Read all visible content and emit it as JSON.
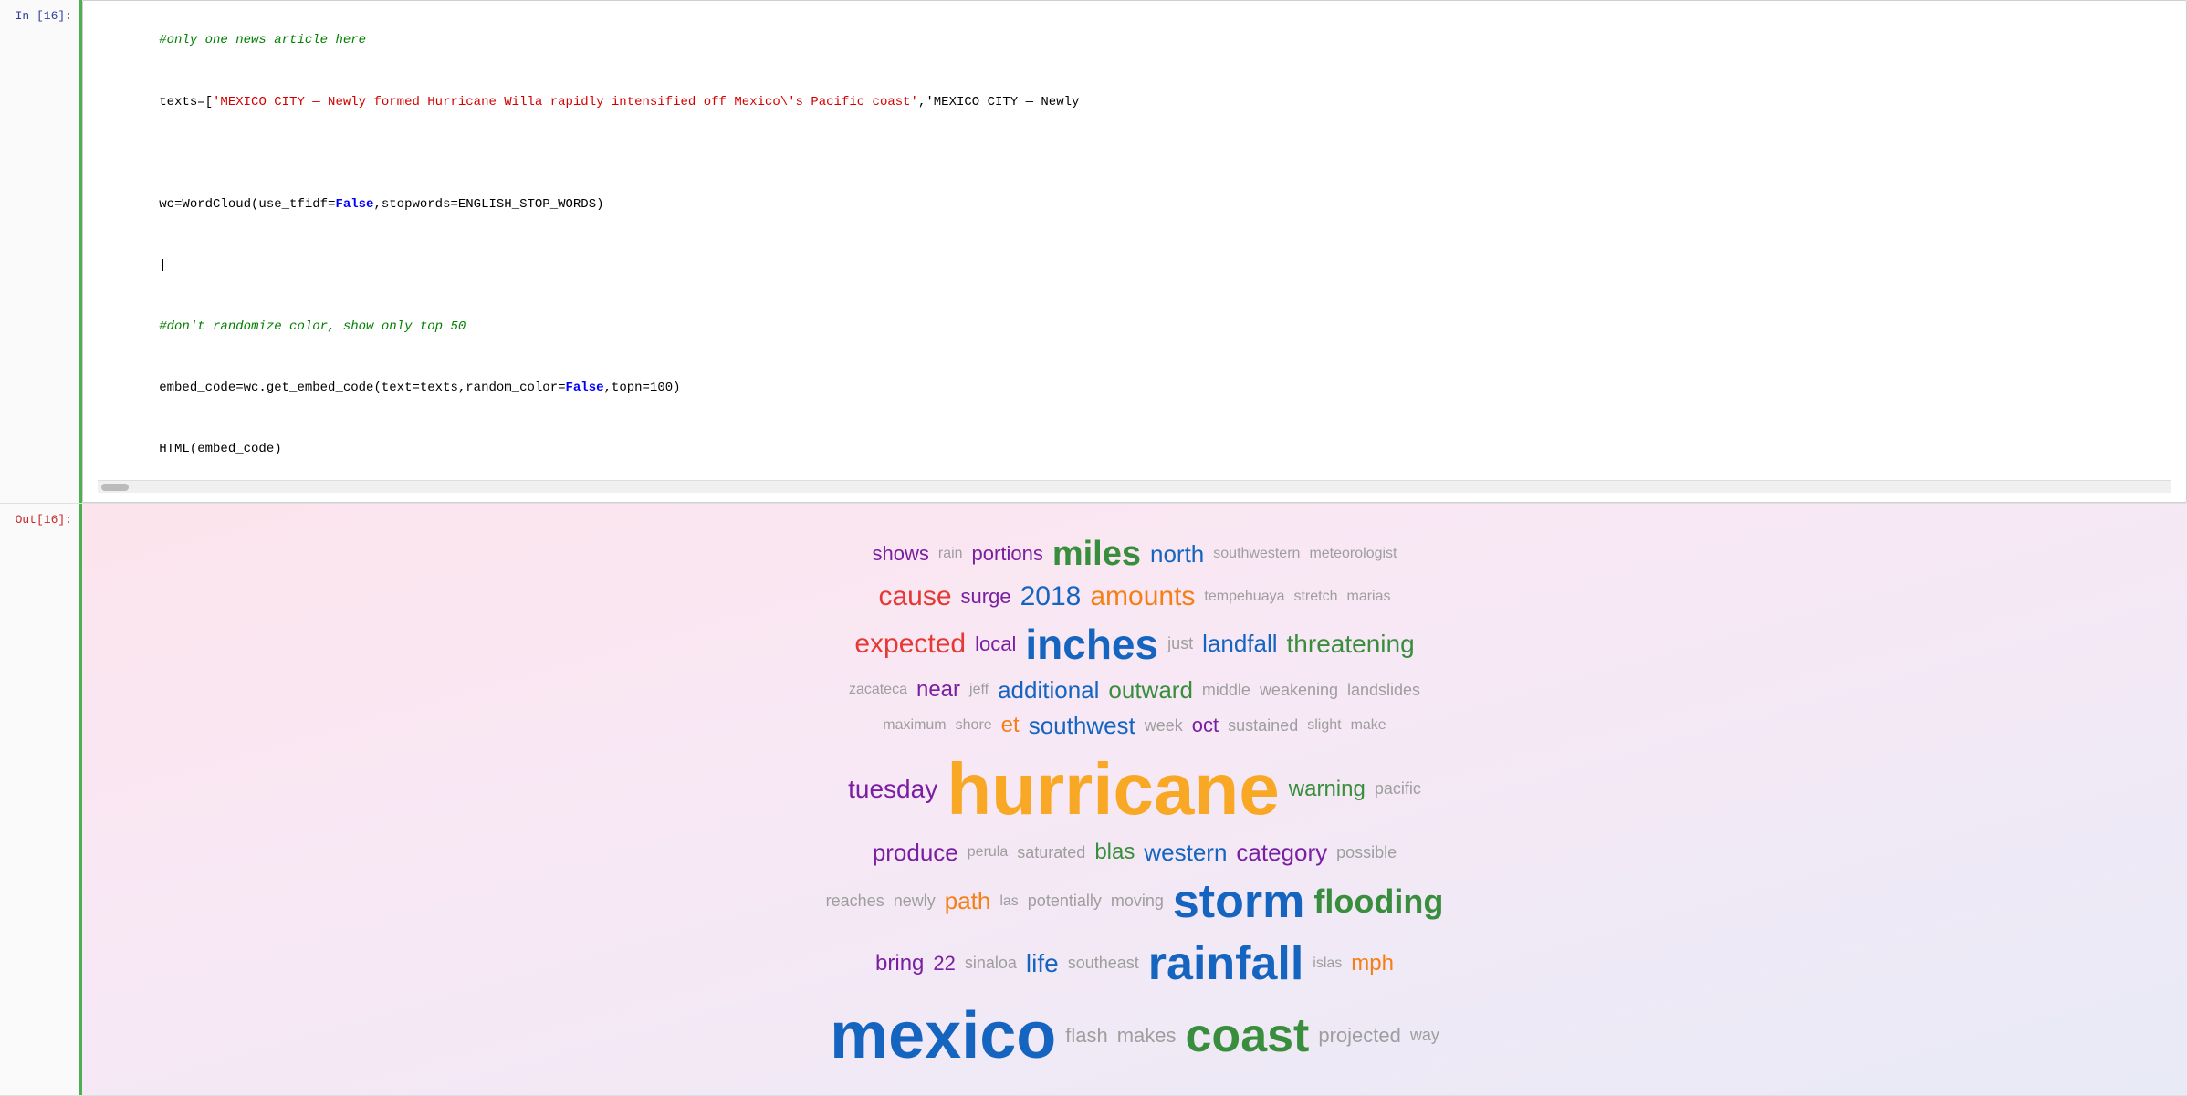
{
  "in_label": "In [16]:",
  "out_label": "Out[16]:",
  "code": {
    "line1": "#only one news article here",
    "line2_pre": "texts=[",
    "line2_str1": "'MEXICO CITY — Newly formed Hurricane Willa rapidly intensified off Mexico\\'s Pacific coast'",
    "line2_str2": ",'MEXICO CITY — Newly",
    "line3": "",
    "line4": "",
    "line5_pre": "wc=WordCloud(use_tfidf=",
    "line5_false": "False",
    "line5_post": ",stopwords=ENGLISH_STOP_WORDS)",
    "line6": "|",
    "line7": "#don't randomize color, show only top 50",
    "line8_pre": "embed_code=wc.get_embed_code(text=texts,random_color=",
    "line8_false": "False",
    "line8_post": ",topn=100)",
    "line9": "HTML(embed_code)"
  },
  "wordcloud": {
    "rows": [
      [
        {
          "text": "shows",
          "size": 22,
          "color": "#7b1fa2",
          "bold": false
        },
        {
          "text": "rain",
          "size": 16,
          "color": "#9e9e9e",
          "bold": false
        },
        {
          "text": "portions",
          "size": 22,
          "color": "#7b1fa2",
          "bold": false
        },
        {
          "text": "miles",
          "size": 38,
          "color": "#388e3c",
          "bold": true
        },
        {
          "text": "north",
          "size": 26,
          "color": "#1565c0",
          "bold": false
        },
        {
          "text": "southwestern",
          "size": 16,
          "color": "#9e9e9e",
          "bold": false
        },
        {
          "text": "meteorologist",
          "size": 16,
          "color": "#9e9e9e",
          "bold": false
        }
      ],
      [
        {
          "text": "cause",
          "size": 30,
          "color": "#e53935",
          "bold": false
        },
        {
          "text": "surge",
          "size": 22,
          "color": "#7b1fa2",
          "bold": false
        },
        {
          "text": "2018",
          "size": 30,
          "color": "#1565c0",
          "bold": false
        },
        {
          "text": "amounts",
          "size": 30,
          "color": "#f57f17",
          "bold": false
        },
        {
          "text": "tempehuaya",
          "size": 16,
          "color": "#9e9e9e",
          "bold": false
        },
        {
          "text": "stretch",
          "size": 16,
          "color": "#9e9e9e",
          "bold": false
        },
        {
          "text": "marias",
          "size": 16,
          "color": "#9e9e9e",
          "bold": false
        }
      ],
      [
        {
          "text": "expected",
          "size": 30,
          "color": "#e53935",
          "bold": false
        },
        {
          "text": "local",
          "size": 22,
          "color": "#7b1fa2",
          "bold": false
        },
        {
          "text": "inches",
          "size": 46,
          "color": "#1565c0",
          "bold": true
        },
        {
          "text": "just",
          "size": 18,
          "color": "#9e9e9e",
          "bold": false
        },
        {
          "text": "landfall",
          "size": 26,
          "color": "#1565c0",
          "bold": false
        },
        {
          "text": "threatening",
          "size": 28,
          "color": "#388e3c",
          "bold": false
        }
      ],
      [
        {
          "text": "zacateca",
          "size": 16,
          "color": "#9e9e9e",
          "bold": false
        },
        {
          "text": "near",
          "size": 24,
          "color": "#7b1fa2",
          "bold": false
        },
        {
          "text": "jeff",
          "size": 16,
          "color": "#9e9e9e",
          "bold": false
        },
        {
          "text": "additional",
          "size": 26,
          "color": "#1565c0",
          "bold": false
        },
        {
          "text": "outward",
          "size": 26,
          "color": "#388e3c",
          "bold": false
        },
        {
          "text": "middle",
          "size": 18,
          "color": "#9e9e9e",
          "bold": false
        },
        {
          "text": "weakening",
          "size": 18,
          "color": "#9e9e9e",
          "bold": false
        },
        {
          "text": "landslides",
          "size": 18,
          "color": "#9e9e9e",
          "bold": false
        }
      ],
      [
        {
          "text": "maximum",
          "size": 16,
          "color": "#9e9e9e",
          "bold": false
        },
        {
          "text": "shore",
          "size": 16,
          "color": "#9e9e9e",
          "bold": false
        },
        {
          "text": "et",
          "size": 24,
          "color": "#f57f17",
          "bold": false
        },
        {
          "text": "southwest",
          "size": 26,
          "color": "#1565c0",
          "bold": false
        },
        {
          "text": "week",
          "size": 18,
          "color": "#9e9e9e",
          "bold": false
        },
        {
          "text": "oct",
          "size": 22,
          "color": "#7b1fa2",
          "bold": false
        },
        {
          "text": "sustained",
          "size": 18,
          "color": "#9e9e9e",
          "bold": false
        },
        {
          "text": "slight",
          "size": 16,
          "color": "#9e9e9e",
          "bold": false
        },
        {
          "text": "make",
          "size": 16,
          "color": "#9e9e9e",
          "bold": false
        }
      ],
      [
        {
          "text": "tuesday",
          "size": 28,
          "color": "#7b1fa2",
          "bold": false
        },
        {
          "text": "hurricane",
          "size": 80,
          "color": "#f9a825",
          "bold": true
        },
        {
          "text": "warning",
          "size": 24,
          "color": "#388e3c",
          "bold": false
        },
        {
          "text": "pacific",
          "size": 18,
          "color": "#9e9e9e",
          "bold": false
        }
      ],
      [
        {
          "text": "produce",
          "size": 26,
          "color": "#7b1fa2",
          "bold": false
        },
        {
          "text": "perula",
          "size": 16,
          "color": "#9e9e9e",
          "bold": false
        },
        {
          "text": "saturated",
          "size": 18,
          "color": "#9e9e9e",
          "bold": false
        },
        {
          "text": "blas",
          "size": 24,
          "color": "#388e3c",
          "bold": false
        },
        {
          "text": "western",
          "size": 26,
          "color": "#1565c0",
          "bold": false
        },
        {
          "text": "category",
          "size": 26,
          "color": "#7b1fa2",
          "bold": false
        },
        {
          "text": "possible",
          "size": 18,
          "color": "#9e9e9e",
          "bold": false
        }
      ],
      [
        {
          "text": "reaches",
          "size": 18,
          "color": "#9e9e9e",
          "bold": false
        },
        {
          "text": "newly",
          "size": 18,
          "color": "#9e9e9e",
          "bold": false
        },
        {
          "text": "path",
          "size": 26,
          "color": "#f57f17",
          "bold": false
        },
        {
          "text": "las",
          "size": 16,
          "color": "#9e9e9e",
          "bold": false
        },
        {
          "text": "potentially",
          "size": 18,
          "color": "#9e9e9e",
          "bold": false
        },
        {
          "text": "moving",
          "size": 18,
          "color": "#9e9e9e",
          "bold": false
        },
        {
          "text": "storm",
          "size": 52,
          "color": "#1565c0",
          "bold": true
        },
        {
          "text": "flooding",
          "size": 36,
          "color": "#388e3c",
          "bold": true
        }
      ],
      [
        {
          "text": "bring",
          "size": 24,
          "color": "#7b1fa2",
          "bold": false
        },
        {
          "text": "22",
          "size": 22,
          "color": "#7b1fa2",
          "bold": false
        },
        {
          "text": "sinaloa",
          "size": 18,
          "color": "#9e9e9e",
          "bold": false
        },
        {
          "text": "life",
          "size": 28,
          "color": "#1565c0",
          "bold": false
        },
        {
          "text": "southeast",
          "size": 18,
          "color": "#9e9e9e",
          "bold": false
        },
        {
          "text": "rainfall",
          "size": 52,
          "color": "#1565c0",
          "bold": true
        },
        {
          "text": "islas",
          "size": 16,
          "color": "#9e9e9e",
          "bold": false
        },
        {
          "text": "mph",
          "size": 24,
          "color": "#f57f17",
          "bold": false
        }
      ],
      [
        {
          "text": "mexico",
          "size": 72,
          "color": "#1565c0",
          "bold": true
        },
        {
          "text": "flash",
          "size": 22,
          "color": "#9e9e9e",
          "bold": false
        },
        {
          "text": "makes",
          "size": 22,
          "color": "#9e9e9e",
          "bold": false
        },
        {
          "text": "coast",
          "size": 52,
          "color": "#388e3c",
          "bold": true
        },
        {
          "text": "projected",
          "size": 22,
          "color": "#9e9e9e",
          "bold": false
        },
        {
          "text": "way",
          "size": 18,
          "color": "#9e9e9e",
          "bold": false
        }
      ]
    ]
  }
}
